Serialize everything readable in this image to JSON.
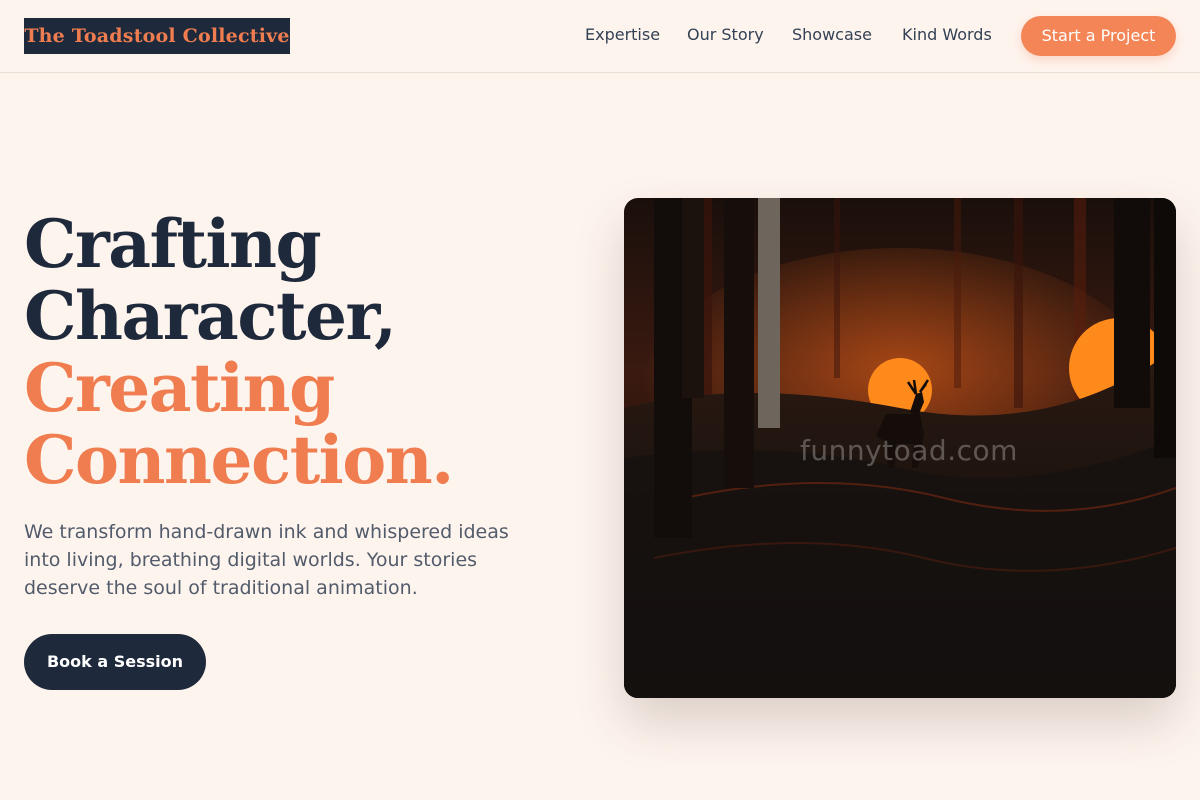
{
  "header": {
    "logo": "The Toadstool Collective",
    "nav": [
      "Expertise",
      "Our Story",
      "Showcase",
      "Kind Words"
    ],
    "cta_label": "Start a Project"
  },
  "hero": {
    "headline_dark": [
      "Crafting",
      "Character,"
    ],
    "headline_accent": [
      "Creating",
      "Connection."
    ],
    "subtext": "We transform hand-drawn ink and whispered ideas into living, breathing digital worlds. Your stories deserve the soul of traditional animation.",
    "button_label": "Book a Session",
    "image_watermark": "funnytoad.com"
  },
  "colors": {
    "background": "#fef4ee",
    "navy": "#1e293b",
    "accent": "#f07d50"
  }
}
